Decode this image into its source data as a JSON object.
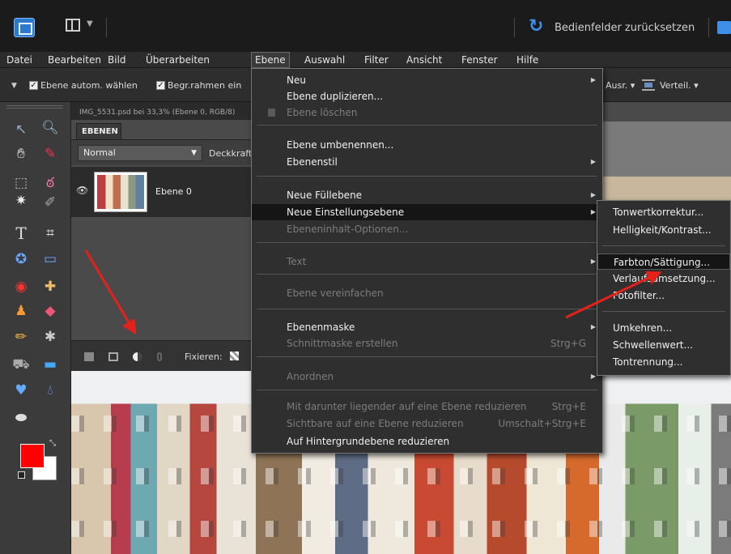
{
  "titlebar": {
    "reset_label": "Bedienfelder zurücksetzen",
    "icons": [
      "app-logo-icon",
      "layout-icon",
      "reset-icon",
      "undo-icon"
    ]
  },
  "menubar": {
    "items": [
      "Datei",
      "Bearbeiten",
      "Bild",
      "Überarbeiten",
      "Ebene",
      "Auswahl",
      "Filter",
      "Ansicht",
      "Fenster",
      "Hilfe"
    ],
    "active": "Ebene"
  },
  "options": {
    "auto_select": "Ebene autom. wählen",
    "bounding_box": "Begr.rahmen ein",
    "align": "Ausr.",
    "distribute": "Verteil."
  },
  "document": {
    "tab_title": "IMG_5531.psd bei 33,3% (Ebene 0, RGB/8)"
  },
  "layers_panel": {
    "tab": "EBENEN",
    "blend_mode": "Normal",
    "opacity_label": "Deckkraft",
    "layer_name": "Ebene 0",
    "lock_label": "Fixieren:"
  },
  "menu": {
    "items": [
      {
        "label": "Neu",
        "submenu": true
      },
      {
        "label": "Ebene duplizieren..."
      },
      {
        "label": "Ebene löschen",
        "disabled": true
      },
      {
        "label": "Ebene umbenennen..."
      },
      {
        "label": "Ebenenstil",
        "submenu": true
      },
      {
        "label": "Neue Füllebene",
        "submenu": true
      },
      {
        "label": "Neue Einstellungsebene",
        "submenu": true,
        "highlighted": true
      },
      {
        "label": "Ebeneninhalt-Optionen...",
        "disabled": true
      },
      {
        "label": "Text",
        "disabled": true,
        "submenu": true
      },
      {
        "label": "Ebene vereinfachen",
        "disabled": true
      },
      {
        "label": "Ebenenmaske",
        "submenu": true
      },
      {
        "label": "Schnittmaske erstellen",
        "disabled": true,
        "shortcut": "Strg+G"
      },
      {
        "label": "Anordnen",
        "disabled": true,
        "submenu": true
      },
      {
        "label": "Mit darunter liegender auf eine Ebene reduzieren",
        "disabled": true,
        "shortcut": "Strg+E"
      },
      {
        "label": "Sichtbare auf eine Ebene reduzieren",
        "disabled": true,
        "shortcut": "Umschalt+Strg+E"
      },
      {
        "label": "Auf Hintergrundebene reduzieren"
      }
    ]
  },
  "submenu": {
    "items": [
      {
        "label": "Tonwertkorrektur..."
      },
      {
        "label": "Helligkeit/Kontrast..."
      },
      {
        "label": "Farbton/Sättigung...",
        "highlighted": true
      },
      {
        "label": "Verlaufsumsetzung..."
      },
      {
        "label": "Fotofilter..."
      },
      {
        "label": "Umkehren..."
      },
      {
        "label": "Schwellenwert..."
      },
      {
        "label": "Tontrennung..."
      }
    ]
  },
  "colors": {
    "foreground": "#ff0000",
    "background": "#ffffff",
    "annotation_arrow": "#e8201a",
    "accent": "#3d8fe8"
  }
}
